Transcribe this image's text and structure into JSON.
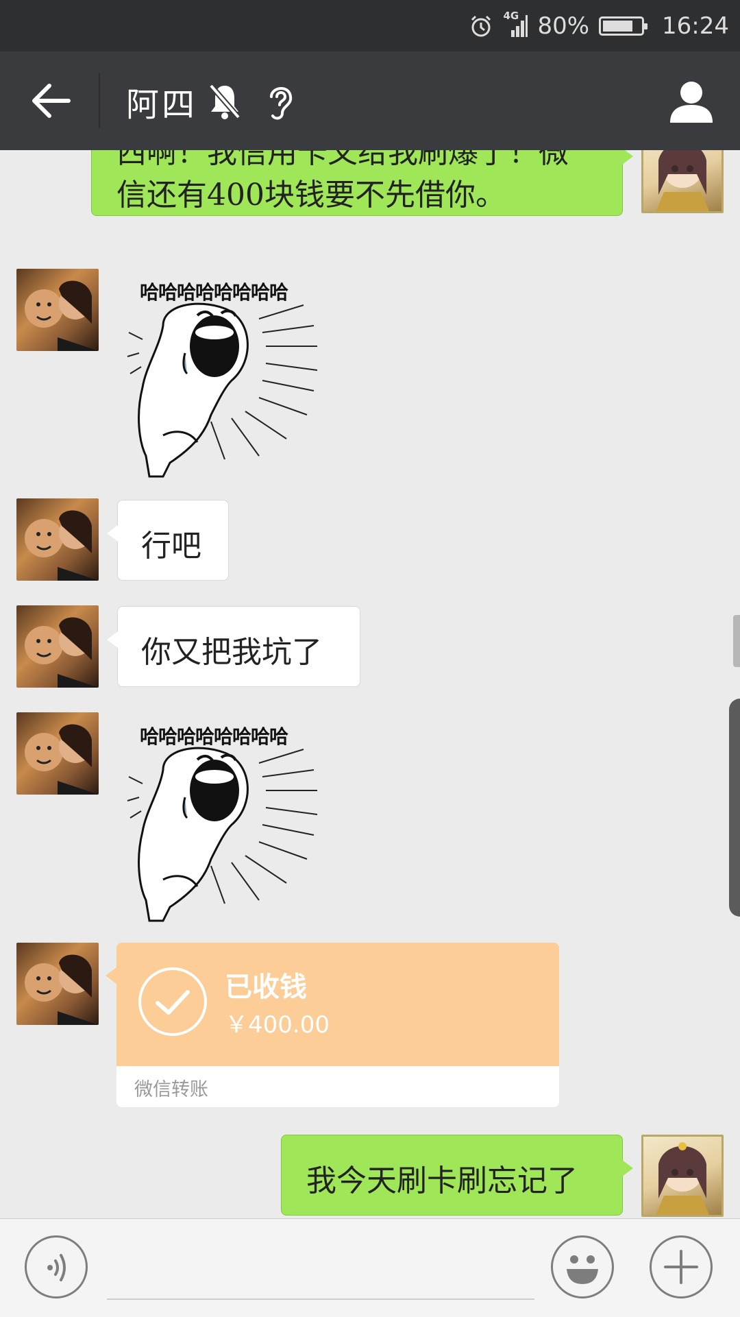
{
  "status_bar": {
    "network": "4G",
    "battery": "80%",
    "battery_level": 0.8,
    "time": "16:24",
    "icons": [
      "alarm-icon",
      "signal-icon",
      "battery-icon"
    ]
  },
  "header": {
    "title": "阿四",
    "icons": [
      "back-arrow-icon",
      "mute-bell-icon",
      "ear-icon",
      "profile-icon"
    ]
  },
  "messages": [
    {
      "from": "me",
      "type": "text",
      "text_line1": "西啊！我信用卡又给我刷爆了！微",
      "text_line2": "信还有400块钱要不先借你。"
    },
    {
      "from": "friend",
      "type": "sticker",
      "caption": "哈哈哈哈哈哈哈哈"
    },
    {
      "from": "friend",
      "type": "text",
      "text": "行吧"
    },
    {
      "from": "friend",
      "type": "text",
      "text": "你又把我坑了"
    },
    {
      "from": "friend",
      "type": "sticker",
      "caption": "哈哈哈哈哈哈哈哈"
    },
    {
      "from": "friend",
      "type": "transfer",
      "status": "已收钱",
      "amount": "￥400.00",
      "label": "微信转账"
    },
    {
      "from": "me",
      "type": "text",
      "text": "我今天刷卡刷忘记了"
    }
  ],
  "input_bar": {
    "icons": [
      "voice-icon",
      "emoji-icon",
      "plus-icon"
    ]
  },
  "colors": {
    "status_bg": "#2e2f31",
    "header_bg": "#3a3b3e",
    "chat_bg": "#ebebeb",
    "my_bubble": "#9fe658",
    "friend_bubble": "#ffffff",
    "transfer_bg": "#fccd96"
  }
}
